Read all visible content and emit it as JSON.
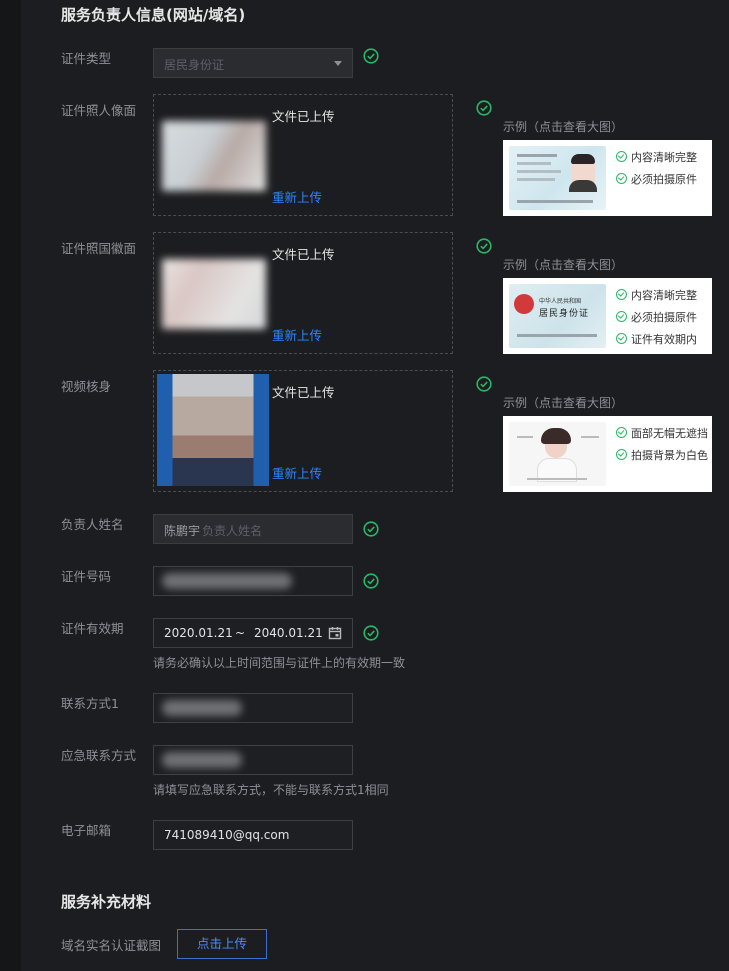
{
  "section1": {
    "title": "服务负责人信息(网站/域名)",
    "id_type": {
      "label": "证件类型",
      "value": "居民身份证"
    },
    "id_front": {
      "label": "证件照人像面",
      "status": "文件已上传",
      "reupload": "重新上传"
    },
    "id_back": {
      "label": "证件照国徽面",
      "status": "文件已上传",
      "reupload": "重新上传"
    },
    "video": {
      "label": "视频核身",
      "status": "文件已上传",
      "reupload": "重新上传"
    },
    "name": {
      "label": "负责人姓名",
      "value": "陈鹏宇",
      "placeholder": "负责人姓名"
    },
    "id_number": {
      "label": "证件号码"
    },
    "validity": {
      "label": "证件有效期",
      "start": "2020.01.21",
      "sep": "~",
      "end": "2040.01.21",
      "hint": "请务必确认以上时间范围与证件上的有效期一致"
    },
    "phone1": {
      "label": "联系方式1"
    },
    "emergency": {
      "label": "应急联系方式",
      "hint": "请填写应急联系方式，不能与联系方式1相同"
    },
    "email": {
      "label": "电子邮箱",
      "value": "741089410@qq.com"
    }
  },
  "examples": {
    "title": "示例（点击查看大图）",
    "front": {
      "items": [
        "内容清晰完整",
        "必须拍摄原件"
      ]
    },
    "back": {
      "card_text1": "中华人民共和国",
      "card_text2": "居民身份证",
      "items": [
        "内容清晰完整",
        "必须拍摄原件",
        "证件有效期内"
      ]
    },
    "video": {
      "items": [
        "面部无帽无遮挡",
        "拍摄背景为白色"
      ]
    }
  },
  "section2": {
    "title": "服务补充材料",
    "domain_screenshot": {
      "label": "域名实名认证截图",
      "button": "点击上传"
    }
  },
  "colors": {
    "accent": "#2b86ff",
    "success": "#29b765",
    "background": "#1c1d20"
  }
}
